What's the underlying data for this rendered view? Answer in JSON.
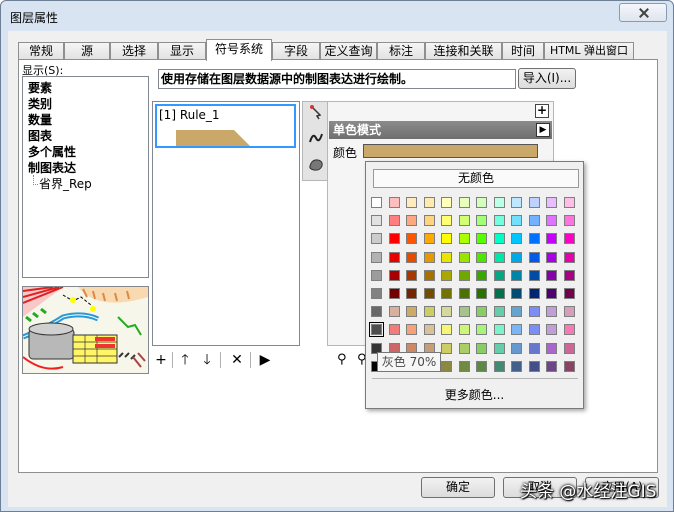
{
  "window": {
    "title": "图层属性"
  },
  "tabs": [
    {
      "label": "常规"
    },
    {
      "label": "源"
    },
    {
      "label": "选择"
    },
    {
      "label": "显示"
    },
    {
      "label": "符号系统"
    },
    {
      "label": "字段"
    },
    {
      "label": "定义查询"
    },
    {
      "label": "标注"
    },
    {
      "label": "连接和关联"
    },
    {
      "label": "时间"
    },
    {
      "label": "HTML 弹出窗口"
    }
  ],
  "active_tab": "符号系统",
  "sidebar": {
    "show_label": "显示(S):",
    "items": [
      {
        "label": "要素"
      },
      {
        "label": "类别"
      },
      {
        "label": "数量"
      },
      {
        "label": "图表"
      },
      {
        "label": "多个属性"
      },
      {
        "label": "制图表达"
      }
    ],
    "sub_item": "省界_Rep"
  },
  "description": "使用存储在图层数据源中的制图表达进行绘制。",
  "import_button": "导入(I)...",
  "rules": [
    {
      "label": "[1] Rule_1",
      "color": "#c9a86a"
    }
  ],
  "rule_toolbar": {
    "add": "+",
    "up": "🡑",
    "down": "🡓",
    "delete": "✕",
    "expand": "▶"
  },
  "properties": {
    "plus_symbol": "+",
    "header": "单色模式",
    "color_label": "颜色",
    "color_value": "#c9a86a"
  },
  "color_popup": {
    "no_color": "无颜色",
    "more_colors": "更多颜色...",
    "tooltip": "灰色 70%",
    "rows": [
      [
        "#ffffff",
        "#ffbebe",
        "#ffebbe",
        "#ffebaf",
        "#ffffbe",
        "#e9ffbe",
        "#d3ffbe",
        "#beffe8",
        "#bee8ff",
        "#bed2ff",
        "#e8beff",
        "#ffbee8"
      ],
      [
        "#e1e1e1",
        "#ff7f7f",
        "#ffa77f",
        "#ffd37f",
        "#ffff73",
        "#d1ff73",
        "#a3ff73",
        "#73ffdf",
        "#73dfff",
        "#73b2ff",
        "#df73ff",
        "#ff73df"
      ],
      [
        "#cccccc",
        "#ff0000",
        "#ff5500",
        "#ffaa00",
        "#ffff00",
        "#aaff00",
        "#55ff00",
        "#00ffc5",
        "#00c5ff",
        "#0070ff",
        "#c500ff",
        "#ff00c5"
      ],
      [
        "#b2b2b2",
        "#e60000",
        "#e64c00",
        "#e69800",
        "#e6e600",
        "#98e600",
        "#4ce600",
        "#00e6a9",
        "#00a9e6",
        "#005ce6",
        "#a900e6",
        "#e600a9"
      ],
      [
        "#9c9c9c",
        "#a80000",
        "#a83800",
        "#a87000",
        "#a8a800",
        "#70a800",
        "#38a800",
        "#00a884",
        "#0084a8",
        "#004da8",
        "#8400a8",
        "#a80084"
      ],
      [
        "#828282",
        "#730000",
        "#732600",
        "#734c00",
        "#737300",
        "#4c7300",
        "#267300",
        "#00734c",
        "#004c73",
        "#002673",
        "#4c0073",
        "#73004c"
      ],
      [
        "#686868",
        "#d7b09e",
        "#cdaa66",
        "#cdcd66",
        "#d7d79e",
        "#a5c48d",
        "#89cd66",
        "#66cdab",
        "#66a3cd",
        "#7a8ef5",
        "#c29ed7",
        "#d69dbc"
      ],
      [
        "#4e4e4e",
        "#f57a7a",
        "#f5a27a",
        "#d7c29e",
        "#f5f57a",
        "#cdf57a",
        "#a5f57a",
        "#7af5ca",
        "#7ab6f5",
        "#7a8ef5",
        "#c29ed7",
        "#f57ab6"
      ],
      [
        "#343434",
        "#cd6666",
        "#cd8966",
        "#c29e7a",
        "#cdcd66",
        "#aacd66",
        "#89cd66",
        "#66cdab",
        "#6699cd",
        "#6677cd",
        "#aa66cd",
        "#cd6699"
      ],
      [
        "#000000",
        "#894444",
        "#895a44",
        "#897044",
        "#898944",
        "#728944",
        "#5c8944",
        "#448970",
        "#445f89",
        "#444f89",
        "#704489",
        "#894465"
      ]
    ]
  },
  "footer": {
    "ok": "确定",
    "cancel": "取消",
    "apply": "应用(A)"
  },
  "watermark": "头条 @水经注GIS"
}
